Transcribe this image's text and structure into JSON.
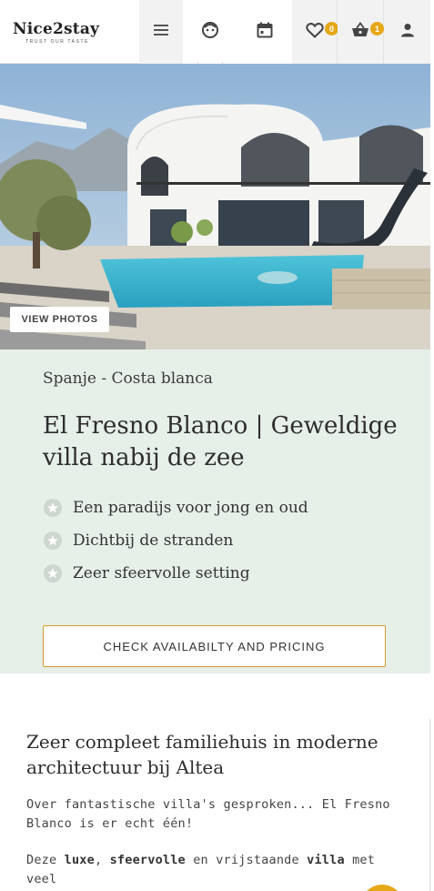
{
  "header": {
    "logo_text": "Nice2stay",
    "logo_tagline": "TRUST OUR TASTE",
    "icons": {
      "menu": "hamburger-menu-icon",
      "kids": "face-icon",
      "calendar": "calendar-icon",
      "favorites": "heart-icon",
      "basket": "basket-icon",
      "account": "person-icon"
    },
    "favorites_count": "0",
    "basket_count": "1",
    "badge_color": "#e6a817"
  },
  "hero": {
    "view_photos_label": "VIEW PHOTOS"
  },
  "property": {
    "location": "Spanje - Costa blanca",
    "title": "El Fresno Blanco | Geweldige villa nabij de zee",
    "usps": [
      "Een paradijs voor jong en oud",
      "Dichtbij de stranden",
      "Zeer sfeervolle setting"
    ],
    "cta_label": "CHECK AVAILABILTY AND PRICING",
    "panel_color": "#e6efe8",
    "accent_color": "#d49a2a"
  },
  "description": {
    "heading": "Zeer compleet familiehuis in moderne architectuur bij Altea",
    "paragraph1": "Over fantastische villa's gesproken... El Fresno Blanco is er echt één!",
    "p2_text1": "Deze ",
    "p2_bold1": "luxe",
    "p2_text2": ", ",
    "p2_bold2": "sfeervolle",
    "p2_text3": " en vrijstaande ",
    "p2_bold3": "villa",
    "p2_text4": " met veel"
  }
}
